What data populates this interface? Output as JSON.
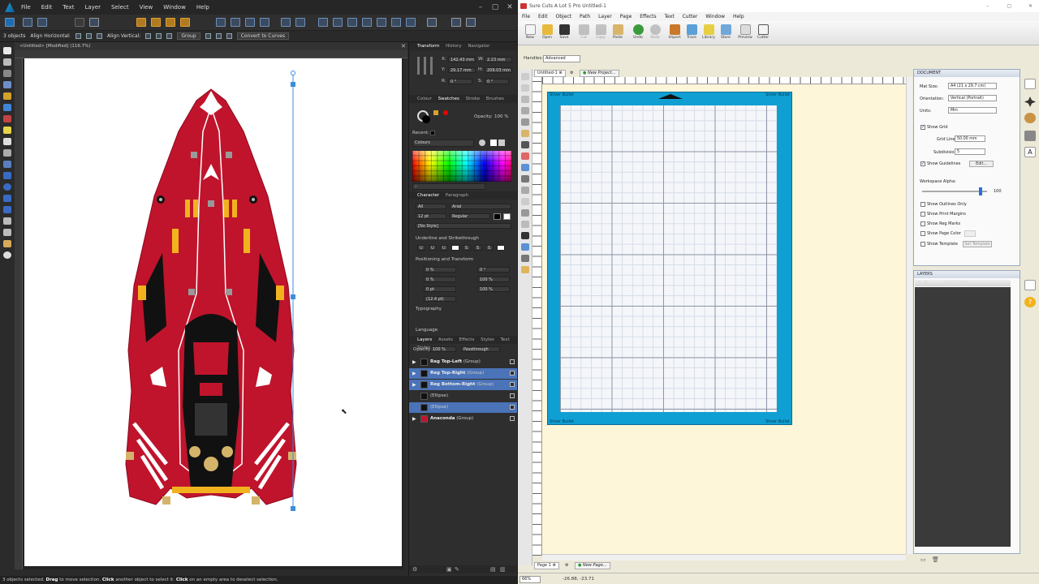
{
  "designer": {
    "menu": [
      "File",
      "Edit",
      "Text",
      "Layer",
      "Select",
      "View",
      "Window",
      "Help"
    ],
    "context": {
      "selection": "3 objects",
      "align_h": "Align Horizontal:",
      "align_v": "Align Vertical:",
      "group": "Group",
      "convert": "Convert to Curves"
    },
    "doc_tab": "<Untitled> [Modified] (116.7%)",
    "panel": {
      "tabs1": [
        "Transform",
        "History",
        "Navigator"
      ],
      "transform": {
        "x_label": "X:",
        "x": "142.43 mm",
        "w_label": "W:",
        "w": "2.23 mm",
        "y_label": "Y:",
        "y": "29.17 mm",
        "h_label": "H:",
        "h": "209.03 mm",
        "r_label": "R:",
        "r": "0 °",
        "s_label": "S:",
        "s": "0 °"
      },
      "tabs2": [
        "Colour",
        "Swatches",
        "Stroke",
        "Brushes"
      ],
      "opacity_label": "Opacity:",
      "opacity": "100 %",
      "recent": "Recent:",
      "palette": "Colours",
      "tabs3": [
        "Character",
        "Paragraph"
      ],
      "char": {
        "scope": "All",
        "font": "Arial",
        "size": "12 pt",
        "weight": "Regular",
        "style": "[No Style]"
      },
      "sections": [
        "Underline and Strikethrough",
        "Positioning and Transform",
        "Typography",
        "Language"
      ],
      "positioning": {
        "a": "0 %",
        "b": "0 °",
        "c": "0 %",
        "d": "100 %",
        "e": "0 pt",
        "f": "100 %",
        "g": "(12.4 pt)"
      },
      "tabs4": [
        "Layers",
        "Assets",
        "Effects",
        "Styles",
        "Text Styles"
      ],
      "layers_opacity": "100 %",
      "blend": "Passthrough",
      "layers": [
        {
          "name": "Reg Top-Left",
          "type": "(Group)"
        },
        {
          "name": "Reg Top-Right",
          "type": "(Group)"
        },
        {
          "name": "Reg Bottom-Right",
          "type": "(Group)"
        },
        {
          "name": "",
          "type": "(Ellipse)"
        },
        {
          "name": "",
          "type": "(Ellipse)"
        },
        {
          "name": "Anaconda",
          "type": "(Group)"
        }
      ]
    },
    "status": {
      "a": "3 objects selected.",
      "b": "Drag",
      "c": "to move selection.",
      "d": "Click",
      "e": "another object to select it.",
      "f": "Click",
      "g": "on an empty area to deselect selection."
    }
  },
  "surecuts": {
    "title": "Sure Cuts A Lot 5 Pro Untitled-1",
    "menu": [
      "File",
      "Edit",
      "Object",
      "Path",
      "Layer",
      "Page",
      "Effects",
      "Text",
      "Cutter",
      "Window",
      "Help"
    ],
    "toolbar": [
      "New",
      "Open",
      "Save",
      "Cut",
      "Copy",
      "Paste",
      "Undo",
      "Redo",
      "Import",
      "Trace",
      "Library",
      "Store",
      "Preview",
      "Cutter"
    ],
    "handles_label": "Handles:",
    "handles_value": "Advanced",
    "doc_tab": "Untitled-1",
    "new_project": "New Project...",
    "mat_label": "Silver Bullet",
    "document": {
      "title": "DOCUMENT",
      "mat_size_label": "Mat Size:",
      "mat_size": "A4 (21 x 29.7 cm)",
      "orientation_label": "Orientation:",
      "orientation": "Vertical (Portrait)",
      "units_label": "Units:",
      "units": "Mm",
      "show_grid": "Show Grid",
      "grid_lines_label": "Grid Lines:",
      "grid_lines": "50.00 mm",
      "subdivision_label": "Subdivision:",
      "subdivision": "5",
      "show_guidelines": "Show Guidelines",
      "edit": "Edit...",
      "workspace_alpha": "Workspace Alpha:",
      "alpha_value": "100",
      "outlines": "Show Outlines Only",
      "print_margins": "Show Print Margins",
      "reg_marks": "Show Reg Marks",
      "page_color": "Show Page Color",
      "template": "Show Template",
      "set_template": "Set Template"
    },
    "layers": {
      "title": "LAYERS",
      "col": "Layer Name"
    },
    "pages": {
      "page": "Page 1",
      "new_page": "New Page..."
    },
    "status": {
      "zoom": "66%",
      "coords": "-26.88, -23.71"
    }
  }
}
